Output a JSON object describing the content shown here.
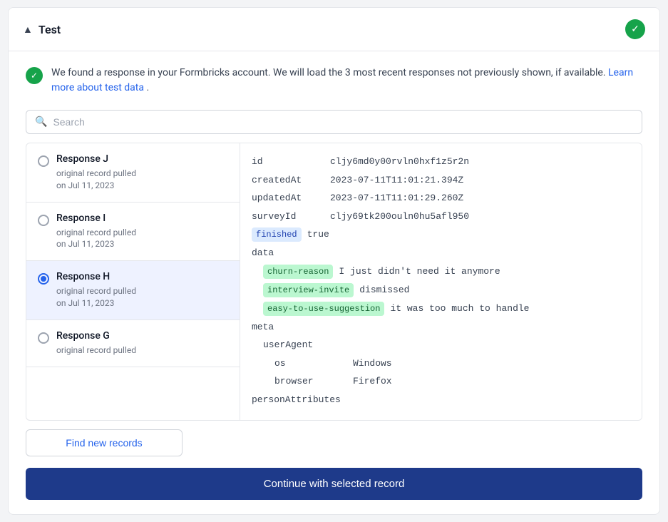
{
  "header": {
    "title": "Test",
    "chevron": "▲",
    "check_icon": "✓"
  },
  "info_banner": {
    "text_main": "We found a response in your Formbricks account. We will load the 3 most recent responses not previously shown, if available.",
    "link_text": "Learn more about test data",
    "text_end": "."
  },
  "search": {
    "placeholder": "Search"
  },
  "responses": [
    {
      "id": "response-j",
      "name": "Response J",
      "date_line1": "original record pulled",
      "date_line2": "on Jul 11, 2023",
      "selected": false
    },
    {
      "id": "response-i",
      "name": "Response I",
      "date_line1": "original record pulled",
      "date_line2": "on Jul 11, 2023",
      "selected": false
    },
    {
      "id": "response-h",
      "name": "Response H",
      "date_line1": "original record pulled",
      "date_line2": "on Jul 11, 2023",
      "selected": true
    },
    {
      "id": "response-g",
      "name": "Response G",
      "date_line1": "original record pulled",
      "date_line2": "",
      "selected": false
    }
  ],
  "data_panel": {
    "fields": [
      {
        "indent": 0,
        "key": "id",
        "badge": false,
        "value": "cljy6md0y00rvln0hxf1z5r2n"
      },
      {
        "indent": 0,
        "key": "createdAt",
        "badge": false,
        "value": "2023-07-11T11:01:21.394Z"
      },
      {
        "indent": 0,
        "key": "updatedAt",
        "badge": false,
        "value": "2023-07-11T11:01:29.260Z"
      },
      {
        "indent": 0,
        "key": "surveyId",
        "badge": false,
        "value": "cljy69tk200ouln0hu5afl950"
      },
      {
        "indent": 0,
        "key": "finished",
        "badge": true,
        "badge_color": "blue",
        "value": "true"
      },
      {
        "indent": 0,
        "key": "data",
        "badge": false,
        "value": ""
      },
      {
        "indent": 1,
        "key": "churn-reason",
        "badge": true,
        "badge_color": "green",
        "value": "I just didn't need it anymore"
      },
      {
        "indent": 1,
        "key": "interview-invite",
        "badge": true,
        "badge_color": "green",
        "value": "dismissed"
      },
      {
        "indent": 1,
        "key": "easy-to-use-suggestion",
        "badge": true,
        "badge_color": "green",
        "value": "it was too much to handle"
      },
      {
        "indent": 0,
        "key": "meta",
        "badge": false,
        "value": ""
      },
      {
        "indent": 1,
        "key": "userAgent",
        "badge": false,
        "value": ""
      },
      {
        "indent": 2,
        "key": "os",
        "badge": false,
        "value": "Windows"
      },
      {
        "indent": 2,
        "key": "browser",
        "badge": false,
        "value": "Firefox"
      },
      {
        "indent": 0,
        "key": "personAttributes",
        "badge": false,
        "value": ""
      }
    ]
  },
  "buttons": {
    "find_records": "Find new records",
    "continue": "Continue with selected record"
  }
}
